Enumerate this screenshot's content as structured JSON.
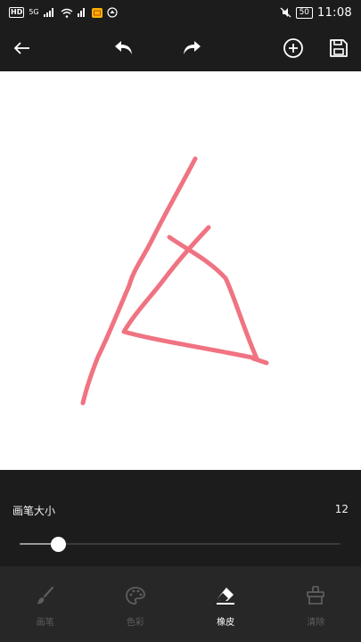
{
  "status_bar": {
    "network_badge": "HD",
    "network_gen": "5G",
    "battery_level": "50",
    "time": "11:08"
  },
  "toolbar": {
    "icons": [
      "back-arrow-icon",
      "undo-icon",
      "redo-icon",
      "add-circle-icon",
      "save-icon"
    ]
  },
  "canvas": {
    "stroke_color": "#f07382",
    "background": "#ffffff"
  },
  "brush": {
    "size_label": "画笔大小",
    "size_value": "12",
    "slider_fraction": 0.12
  },
  "tabs": [
    {
      "label": "画笔",
      "icon": "brush-icon",
      "active": false
    },
    {
      "label": "色彩",
      "icon": "palette-icon",
      "active": false
    },
    {
      "label": "橡皮",
      "icon": "eraser-icon",
      "active": true
    },
    {
      "label": "清除",
      "icon": "clear-icon",
      "active": false
    }
  ],
  "colors": {
    "toolbar_bg": "#1c1c1c",
    "tab_bar_bg": "#272727",
    "active_tab": "#ffffff",
    "inactive_tab": "#5e5e5e"
  }
}
